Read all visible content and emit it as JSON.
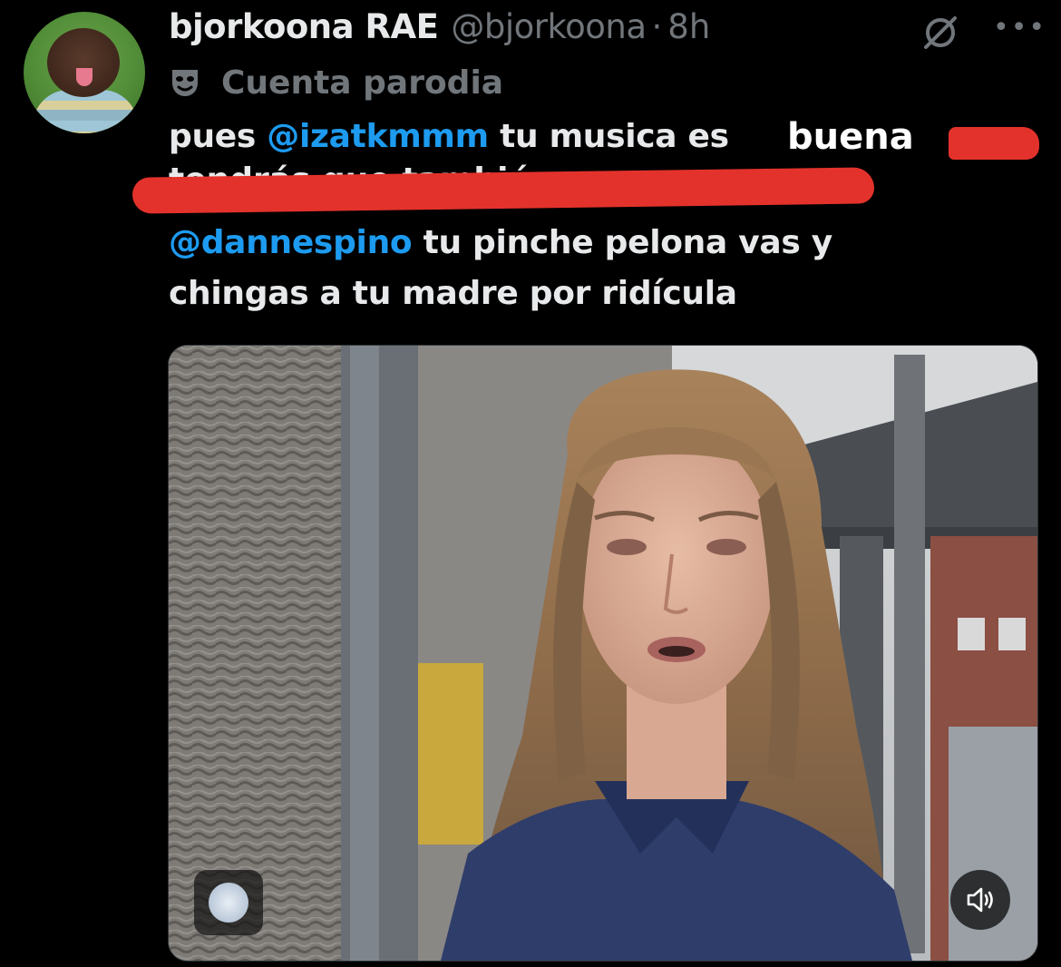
{
  "author": {
    "display_name": "bjorkoona RAE",
    "handle": "@bjorkoona",
    "separator": "·",
    "time": "8h",
    "label": "Cuenta parodia"
  },
  "tweet": {
    "line1_prefix": "pues ",
    "line1_mention": "@izatkmmm",
    "line1_suffix": " tu musica es",
    "overlay_word": "buena",
    "line2_struck": "tendrás que también",
    "line3_mention": "@dannespino",
    "line3_suffix": " tu pinche pelona vas y",
    "line4": "chingas a tu madre por ridícula"
  },
  "colors": {
    "background": "#000000",
    "text": "#e7e9ea",
    "secondary": "#71767b",
    "mention": "#1d9bf0",
    "redaction": "#e3322b"
  },
  "icons": {
    "grok": "grok-icon",
    "more": "more-icon",
    "parody": "mask-icon",
    "sound": "speaker-icon"
  }
}
